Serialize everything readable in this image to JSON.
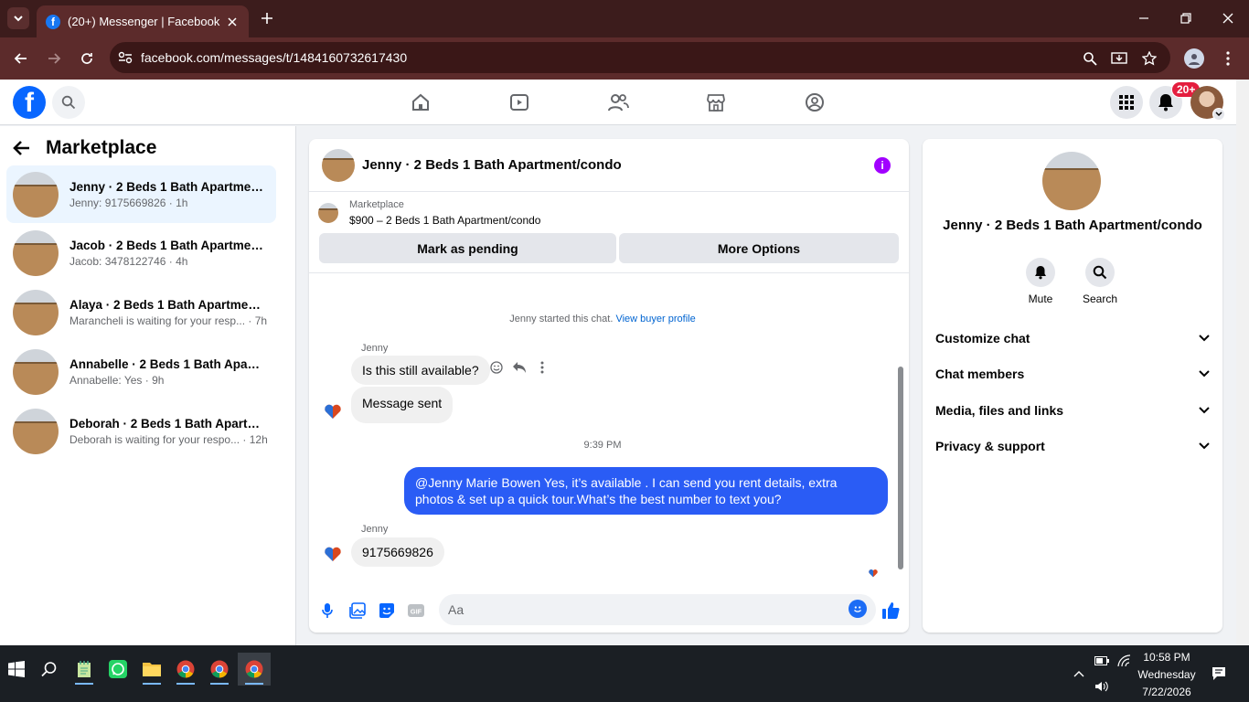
{
  "browser": {
    "tab_title": "(20+) Messenger | Facebook",
    "url": "facebook.com/messages/t/1484160732617430"
  },
  "header": {
    "notification_badge": "20+"
  },
  "sidebar": {
    "title": "Marketplace",
    "conversations": [
      {
        "name": "Jenny · 2 Beds 1 Bath Apartment/condo",
        "preview": "Jenny: 9175669826 · 1h"
      },
      {
        "name": "Jacob · 2 Beds 1 Bath Apartment/condo",
        "preview": "Jacob: 3478122746 · 4h"
      },
      {
        "name": "Alaya · 2 Beds 1 Bath Apartment/condo",
        "preview": "Marancheli is waiting for your resp... · 7h"
      },
      {
        "name": "Annabelle · 2 Beds 1 Bath Apartment/condo",
        "preview": "Annabelle: Yes · 9h"
      },
      {
        "name": "Deborah · 2 Beds 1 Bath Apartment/condo",
        "preview": "Deborah is waiting for your respo... · 12h"
      }
    ]
  },
  "chat": {
    "title": "Jenny · 2 Beds 1 Bath Apartment/condo",
    "marketplace_label": "Marketplace",
    "listing": "$900 – 2 Beds 1 Bath Apartment/condo",
    "mark_pending": "Mark as pending",
    "more_options": "More Options",
    "system_text": "Jenny started this chat.",
    "system_link": "View buyer profile",
    "sender1": "Jenny",
    "msg1": "Is this still available?",
    "msg2": "Message sent",
    "timestamp": "9:39 PM",
    "msg_out": "@Jenny Marie Bowen Yes, it’s available .  I can send you rent details, extra photos & set up a quick tour.What’s the best number to text you?",
    "sender2": "Jenny",
    "msg3": "9175669826",
    "composer_placeholder": "Aa"
  },
  "info_panel": {
    "name": "Jenny · 2 Beds 1 Bath Apartment/condo",
    "mute": "Mute",
    "search": "Search",
    "sections": [
      "Customize chat",
      "Chat members",
      "Media, files and links",
      "Privacy & support"
    ]
  },
  "taskbar": {
    "time": "10:58 PM",
    "day": "Wednesday",
    "date": "7/22/2026"
  },
  "colors": {
    "brand": "#0866ff",
    "outgoing_bubble": "#2a5cf5",
    "chrome_bg": "#5c2b2b",
    "active_conv": "#ebf5ff"
  }
}
